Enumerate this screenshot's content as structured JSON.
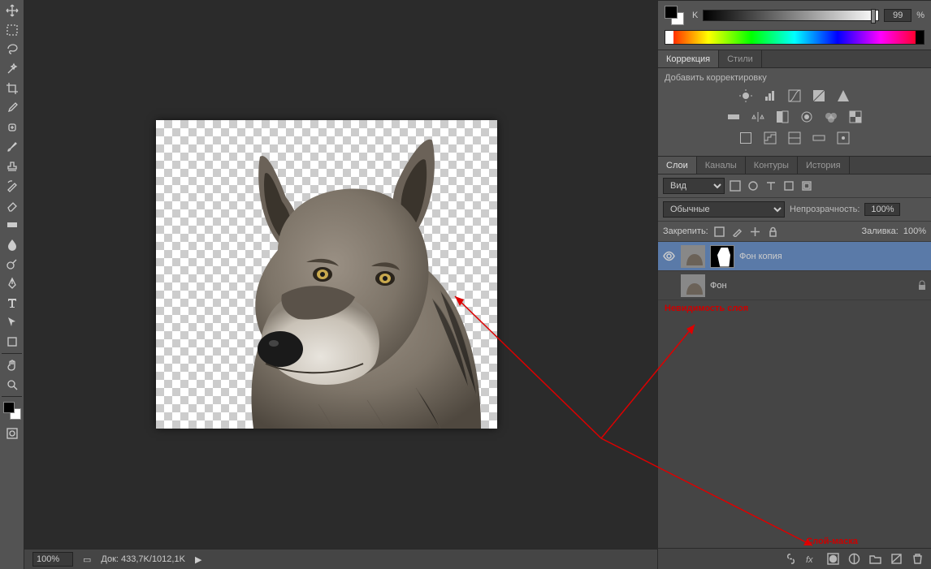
{
  "status": {
    "zoom": "100%",
    "doc_info": "Док: 433,7K/1012,1K"
  },
  "color_panel": {
    "channel_label": "K",
    "value": "99",
    "unit": "%"
  },
  "adjustments_panel": {
    "tabs": [
      "Коррекция",
      "Стили"
    ],
    "add_label": "Добавить корректировку"
  },
  "layers_panel": {
    "tabs": [
      "Слои",
      "Каналы",
      "Контуры",
      "История"
    ],
    "filter_label": "Вид",
    "blend_mode": "Обычные",
    "opacity_label": "Непрозрачность:",
    "opacity_value": "100%",
    "lock_label": "Закрепить:",
    "fill_label": "Заливка:",
    "fill_value": "100%",
    "layers": [
      {
        "name": "Фон копия",
        "visible": true,
        "selected": true,
        "has_mask": true,
        "locked": false
      },
      {
        "name": "Фон",
        "visible": false,
        "selected": false,
        "has_mask": false,
        "locked": true
      }
    ]
  },
  "annotations": {
    "visibility_note": "Невидимость слоя",
    "mask_note": "Слой-маска"
  },
  "canvas": {
    "subject": "wolf-head",
    "background": "transparent-checker"
  }
}
